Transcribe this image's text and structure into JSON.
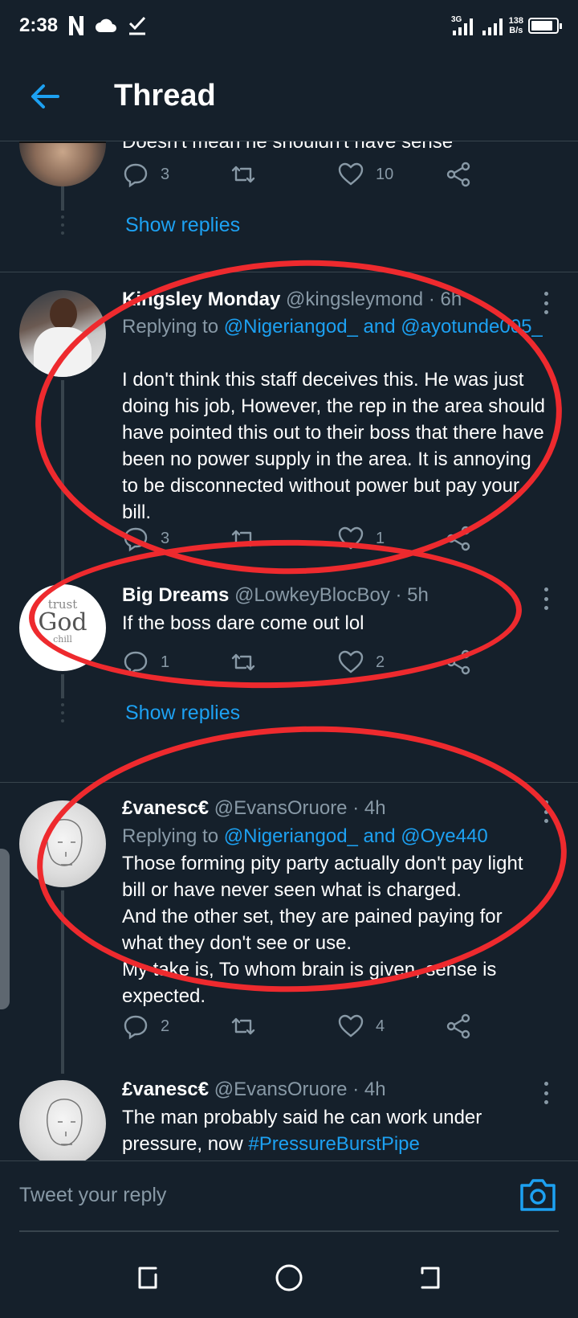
{
  "status_bar": {
    "time": "2:38",
    "network": "3G",
    "speed_value": "138",
    "speed_unit": "B/s"
  },
  "header": {
    "title": "Thread"
  },
  "partial_tweet": {
    "body": "Doesn't mean he shouldn't have sense",
    "replies": "3",
    "retweets": "",
    "likes": "10"
  },
  "show_replies_label": "Show replies",
  "tweets": [
    {
      "name": "Kingsley Monday",
      "handle": "@kingsleymond",
      "time": "· 6h",
      "replying_prefix": "Replying to",
      "replying_to": "@Nigeriangod_ and @ayotunde005_",
      "body": "I don't think this staff deceives this. He was just doing his job, However, the rep in the area should have pointed this out to their boss that there have been no power supply in the area. It is annoying to be disconnected without power but pay  your bill.",
      "replies": "3",
      "retweets": "",
      "likes": "1"
    },
    {
      "name": "Big Dreams",
      "handle": "@LowkeyBlocBoy",
      "time": "· 5h",
      "body": "If the boss dare come out lol",
      "replies": "1",
      "retweets": "",
      "likes": "2",
      "avatar_text_1": "trust",
      "avatar_text_2": "God",
      "avatar_text_3": "chill"
    },
    {
      "name": "£vanesc€",
      "handle": "@EvansOruore",
      "time": "· 4h",
      "replying_prefix": "Replying to",
      "replying_to": "@Nigeriangod_ and @Oye440",
      "body": "Those forming pity party actually don't pay light bill or have never seen what is charged.\nAnd the other set, they are pained paying for what they don't see or use.\nMy take is, To whom brain is given, sense is expected.",
      "replies": "2",
      "retweets": "",
      "likes": "4"
    },
    {
      "name": "£vanesc€",
      "handle": "@EvansOruore",
      "time": "· 4h",
      "body": "The man probably said he can work under pressure, now",
      "hashtag": "#PressureBurstPipe"
    }
  ],
  "reply_bar": {
    "placeholder": "Tweet your reply"
  },
  "colors": {
    "background": "#15202b",
    "accent": "#1da1f2",
    "secondary_text": "#8899a6",
    "annotation": "#ee2a2e"
  }
}
